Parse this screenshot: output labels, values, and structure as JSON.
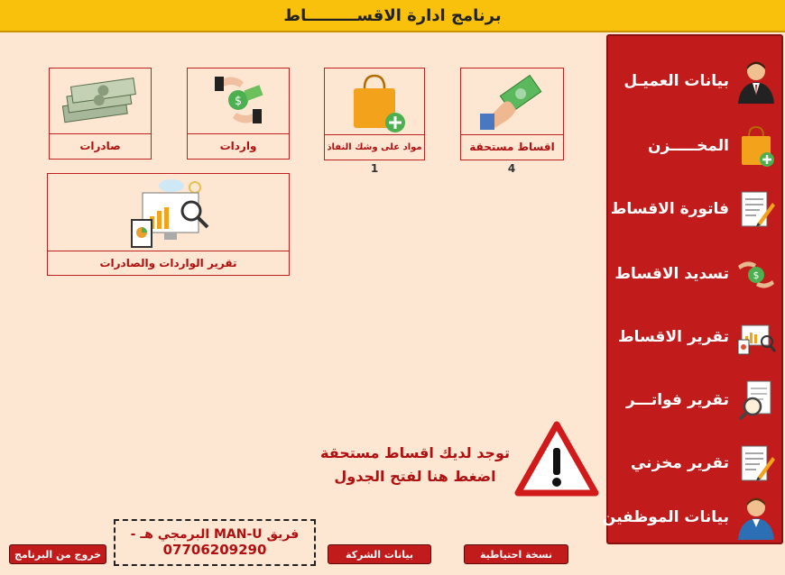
{
  "app": {
    "title": "برنامج ادارة الاقســـــــــاط"
  },
  "sidebar": {
    "items": [
      {
        "label": "بيانات العميـل",
        "icon": "customer-icon"
      },
      {
        "label": "المخـــــزن",
        "icon": "shopping-bag-add-icon"
      },
      {
        "label": "فاتورة الاقساط",
        "icon": "invoice-edit-icon"
      },
      {
        "label": "تسديد الاقساط",
        "icon": "money-hands-icon"
      },
      {
        "label": "تقرير الاقساط",
        "icon": "report-devices-icon"
      },
      {
        "label": "تقرير فواتـــر",
        "icon": "magnifier-document-icon"
      },
      {
        "label": "تقرير مخزني",
        "icon": "document-pencil-icon"
      },
      {
        "label": "بيانات الموظفين",
        "icon": "employee-icon"
      }
    ]
  },
  "tiles": [
    {
      "caption": "اقساط مستحقة",
      "icon": "hand-money-icon",
      "count": "4"
    },
    {
      "caption": "مواد على وشك النفاذ",
      "icon": "shopping-bag-add-icon",
      "count": "1"
    },
    {
      "caption": "واردات",
      "icon": "money-hands-icon"
    },
    {
      "caption": "صادرات",
      "icon": "cash-stack-icon"
    },
    {
      "caption": "تقرير الواردات والصادرات",
      "icon": "report-devices-icon"
    }
  ],
  "alert": {
    "line1": "توجد لديك اقساط مستحقة",
    "line2": "اضغط هنا لفتح الجدول",
    "icon": "warning-icon"
  },
  "footer": {
    "backup": "نسخة احتياطية",
    "company": "بيانات الشركة",
    "exit": "خروج من البرنامج",
    "team_line": "فريق MAN-U البرمجي هـ -",
    "team_phone": "07706209290"
  },
  "colors": {
    "accent": "#c11b1b",
    "title_bar": "#f9c10b",
    "background": "#fde6d2"
  }
}
